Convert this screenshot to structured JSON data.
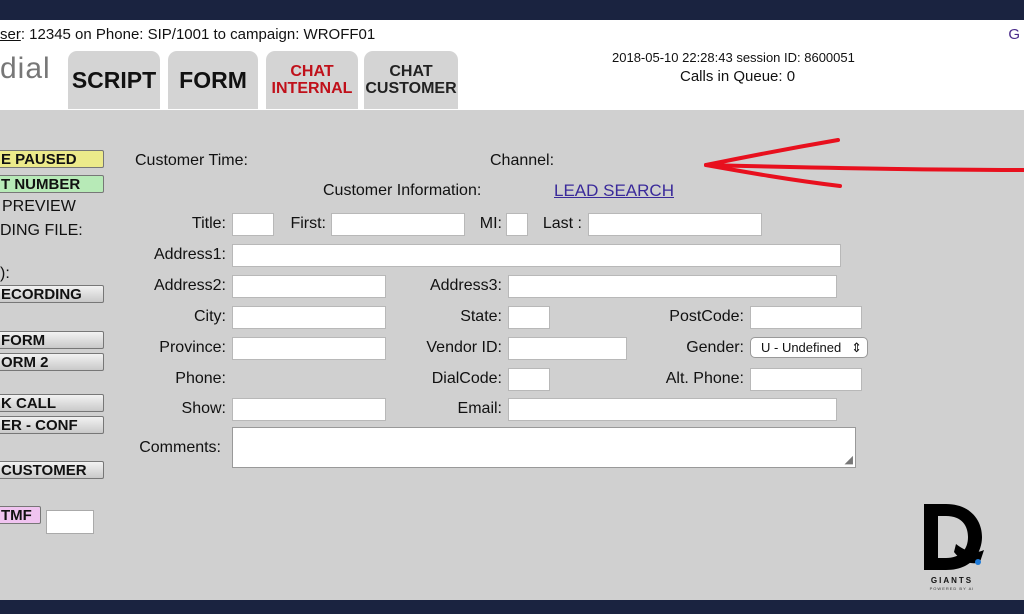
{
  "header": {
    "user_prefix": "ser",
    "user_line": ": 12345 on Phone: SIP/1001  to campaign: WROFF01",
    "corner": "G",
    "logo": "dial",
    "datetime": "2018-05-10 22:28:43    session ID: 8600051",
    "queue": "Calls in Queue: 0"
  },
  "tabs": {
    "script": "SCRIPT",
    "form": "FORM",
    "chat_internal_1": "CHAT",
    "chat_internal_2": "INTERNAL",
    "chat_customer_1": "CHAT",
    "chat_customer_2": "CUSTOMER"
  },
  "sidebar": {
    "paused": "E PAUSED",
    "number": "T NUMBER",
    "preview": "PREVIEW",
    "dialing_file": "DING FILE:",
    "colon": "):",
    "recording": "ECORDING",
    "form": "FORM",
    "form2": "ORM 2",
    "call": "K CALL",
    "conf": "ER - CONF",
    "customer": "CUSTOMER",
    "dtmf": "TMF"
  },
  "info": {
    "customer_time": "Customer Time:",
    "channel": "Channel:",
    "customer_information": "Customer Information:",
    "lead_search": "LEAD SEARCH"
  },
  "form": {
    "title": "Title:",
    "first": "First:",
    "mi": "MI:",
    "last": "Last :",
    "address1": "Address1:",
    "address2": "Address2:",
    "address3": "Address3:",
    "city": "City:",
    "state": "State:",
    "postcode": "PostCode:",
    "province": "Province:",
    "vendor_id": "Vendor ID:",
    "gender": "Gender:",
    "gender_value": "U - Undefined",
    "phone": "Phone:",
    "dialcode": "DialCode:",
    "alt_phone": "Alt. Phone:",
    "show": "Show:",
    "email": "Email:",
    "comments": "Comments:"
  },
  "branding": {
    "word": "GIANTS",
    "tagline": "POWERED BY AI"
  },
  "colors": {
    "accent_red": "#e8101e",
    "link": "#3a2a9a",
    "panel": "#d0d0d0"
  }
}
